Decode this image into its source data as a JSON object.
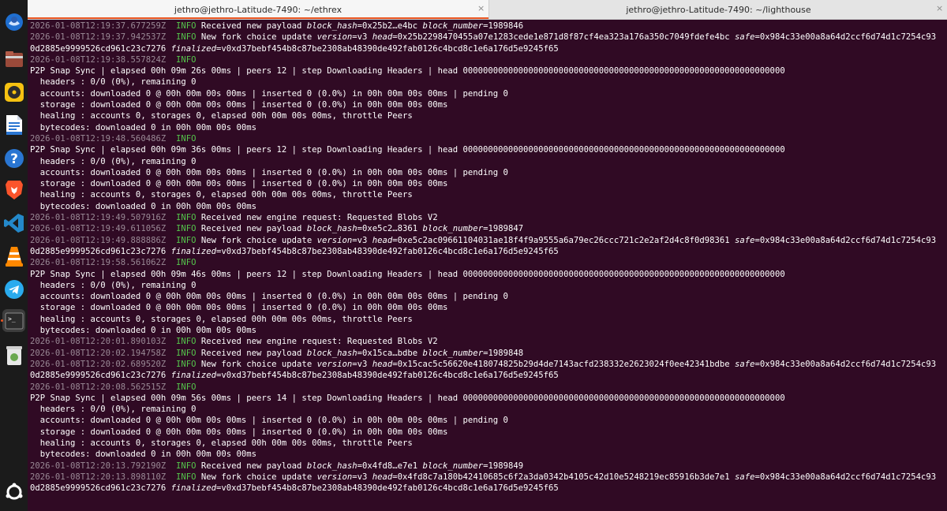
{
  "tabs": [
    {
      "title": "jethro@jethro-Latitude-7490: ~/ethrex",
      "active": true
    },
    {
      "title": "jethro@jethro-Latitude-7490: ~/lighthouse",
      "active": false
    }
  ],
  "close_glyph": "×",
  "dock": [
    {
      "name": "thunderbird-icon",
      "color": "#1f6fd1"
    },
    {
      "name": "files-icon",
      "color": "#9a4a3a"
    },
    {
      "name": "rhythmbox-icon",
      "color": "#f5c211"
    },
    {
      "name": "libreoffice-writer-icon",
      "color": "#2a76d2"
    },
    {
      "name": "help-icon",
      "color": "#2a76d2"
    },
    {
      "name": "brave-browser-icon",
      "color": "#fb542b"
    },
    {
      "name": "vscode-icon",
      "color": "#2489ca"
    },
    {
      "name": "vlc-icon",
      "color": "#ff8800"
    },
    {
      "name": "telegram-icon",
      "color": "#2aabee"
    },
    {
      "name": "terminal-icon",
      "color": "#2b2b2b"
    },
    {
      "name": "trash-icon",
      "color": "#6aa84f"
    },
    {
      "name": "show-apps-icon",
      "color": "#ffffff"
    }
  ],
  "terminal": {
    "lines": [
      [
        {
          "t": "2026-01-08T12:19:37.677259Z",
          "c": "ts"
        },
        {
          "t": "  "
        },
        {
          "t": "INFO",
          "c": "lvl"
        },
        {
          "t": " Received new payload "
        },
        {
          "t": "block_hash",
          "c": "it"
        },
        {
          "t": "=0x25b2…e4bc "
        },
        {
          "t": "block_number",
          "c": "it"
        },
        {
          "t": "=1989846"
        }
      ],
      [
        {
          "t": "2026-01-08T12:19:37.942537Z",
          "c": "ts"
        },
        {
          "t": "  "
        },
        {
          "t": "INFO",
          "c": "lvl"
        },
        {
          "t": " New fork choice update "
        },
        {
          "t": "version",
          "c": "it"
        },
        {
          "t": "=v3 "
        },
        {
          "t": "head",
          "c": "it"
        },
        {
          "t": "=0x25b2298470455a07e1283cede1e871d8f87cf4ea323a176a350c7049fdefe4bc "
        },
        {
          "t": "safe",
          "c": "it"
        },
        {
          "t": "=0x984c33e00a8a64d2ccf6d74d1c7254c93"
        }
      ],
      [
        {
          "t": "0d2885e9999526cd961c23c7276 "
        },
        {
          "t": "finalized",
          "c": "it"
        },
        {
          "t": "=v0xd37bebf454b8c87be2308ab48390de492fab0126c4bcd8c1e6a176d5e9245f65"
        }
      ],
      [
        {
          "t": "2026-01-08T12:19:38.557824Z",
          "c": "ts"
        },
        {
          "t": "  "
        },
        {
          "t": "INFO",
          "c": "lvl"
        }
      ],
      [
        {
          "t": "P2P Snap Sync | elapsed 00h 09m 26s 00ms | peers 12 | step Downloading Headers | head 0000000000000000000000000000000000000000000000000000000000000000"
        }
      ],
      [
        {
          "t": "  headers : 0/0 (0%), remaining 0"
        }
      ],
      [
        {
          "t": "  accounts: downloaded 0 @ 00h 00m 00s 00ms | inserted 0 (0.0%) in 00h 00m 00s 00ms | pending 0"
        }
      ],
      [
        {
          "t": "  storage : downloaded 0 @ 00h 00m 00s 00ms | inserted 0 (0.0%) in 00h 00m 00s 00ms"
        }
      ],
      [
        {
          "t": "  healing : accounts 0, storages 0, elapsed 00h 00m 00s 00ms, throttle Peers"
        }
      ],
      [
        {
          "t": "  bytecodes: downloaded 0 in 00h 00m 00s 00ms"
        }
      ],
      [
        {
          "t": "2026-01-08T12:19:48.560486Z",
          "c": "ts"
        },
        {
          "t": "  "
        },
        {
          "t": "INFO",
          "c": "lvl"
        }
      ],
      [
        {
          "t": "P2P Snap Sync | elapsed 00h 09m 36s 00ms | peers 12 | step Downloading Headers | head 0000000000000000000000000000000000000000000000000000000000000000"
        }
      ],
      [
        {
          "t": "  headers : 0/0 (0%), remaining 0"
        }
      ],
      [
        {
          "t": "  accounts: downloaded 0 @ 00h 00m 00s 00ms | inserted 0 (0.0%) in 00h 00m 00s 00ms | pending 0"
        }
      ],
      [
        {
          "t": "  storage : downloaded 0 @ 00h 00m 00s 00ms | inserted 0 (0.0%) in 00h 00m 00s 00ms"
        }
      ],
      [
        {
          "t": "  healing : accounts 0, storages 0, elapsed 00h 00m 00s 00ms, throttle Peers"
        }
      ],
      [
        {
          "t": "  bytecodes: downloaded 0 in 00h 00m 00s 00ms"
        }
      ],
      [
        {
          "t": "2026-01-08T12:19:49.507916Z",
          "c": "ts"
        },
        {
          "t": "  "
        },
        {
          "t": "INFO",
          "c": "lvl"
        },
        {
          "t": " Received new engine request: Requested Blobs V2"
        }
      ],
      [
        {
          "t": "2026-01-08T12:19:49.611056Z",
          "c": "ts"
        },
        {
          "t": "  "
        },
        {
          "t": "INFO",
          "c": "lvl"
        },
        {
          "t": " Received new payload "
        },
        {
          "t": "block_hash",
          "c": "it"
        },
        {
          "t": "=0xe5c2…8361 "
        },
        {
          "t": "block_number",
          "c": "it"
        },
        {
          "t": "=1989847"
        }
      ],
      [
        {
          "t": "2026-01-08T12:19:49.888886Z",
          "c": "ts"
        },
        {
          "t": "  "
        },
        {
          "t": "INFO",
          "c": "lvl"
        },
        {
          "t": " New fork choice update "
        },
        {
          "t": "version",
          "c": "it"
        },
        {
          "t": "=v3 "
        },
        {
          "t": "head",
          "c": "it"
        },
        {
          "t": "=0xe5c2ac09661104031ae18f4f9a9555a6a79ec26ccc721c2e2af2d4c8f0d98361 "
        },
        {
          "t": "safe",
          "c": "it"
        },
        {
          "t": "=0x984c33e00a8a64d2ccf6d74d1c7254c93"
        }
      ],
      [
        {
          "t": "0d2885e9999526cd961c23c7276 "
        },
        {
          "t": "finalized",
          "c": "it"
        },
        {
          "t": "=v0xd37bebf454b8c87be2308ab48390de492fab0126c4bcd8c1e6a176d5e9245f65"
        }
      ],
      [
        {
          "t": "2026-01-08T12:19:58.561062Z",
          "c": "ts"
        },
        {
          "t": "  "
        },
        {
          "t": "INFO",
          "c": "lvl"
        }
      ],
      [
        {
          "t": "P2P Snap Sync | elapsed 00h 09m 46s 00ms | peers 12 | step Downloading Headers | head 0000000000000000000000000000000000000000000000000000000000000000"
        }
      ],
      [
        {
          "t": "  headers : 0/0 (0%), remaining 0"
        }
      ],
      [
        {
          "t": "  accounts: downloaded 0 @ 00h 00m 00s 00ms | inserted 0 (0.0%) in 00h 00m 00s 00ms | pending 0"
        }
      ],
      [
        {
          "t": "  storage : downloaded 0 @ 00h 00m 00s 00ms | inserted 0 (0.0%) in 00h 00m 00s 00ms"
        }
      ],
      [
        {
          "t": "  healing : accounts 0, storages 0, elapsed 00h 00m 00s 00ms, throttle Peers"
        }
      ],
      [
        {
          "t": "  bytecodes: downloaded 0 in 00h 00m 00s 00ms"
        }
      ],
      [
        {
          "t": "2026-01-08T12:20:01.890103Z",
          "c": "ts"
        },
        {
          "t": "  "
        },
        {
          "t": "INFO",
          "c": "lvl"
        },
        {
          "t": " Received new engine request: Requested Blobs V2"
        }
      ],
      [
        {
          "t": "2026-01-08T12:20:02.194758Z",
          "c": "ts"
        },
        {
          "t": "  "
        },
        {
          "t": "INFO",
          "c": "lvl"
        },
        {
          "t": " Received new payload "
        },
        {
          "t": "block_hash",
          "c": "it"
        },
        {
          "t": "=0x15ca…bdbe "
        },
        {
          "t": "block_number",
          "c": "it"
        },
        {
          "t": "=1989848"
        }
      ],
      [
        {
          "t": "2026-01-08T12:20:02.689520Z",
          "c": "ts"
        },
        {
          "t": "  "
        },
        {
          "t": "INFO",
          "c": "lvl"
        },
        {
          "t": " New fork choice update "
        },
        {
          "t": "version",
          "c": "it"
        },
        {
          "t": "=v3 "
        },
        {
          "t": "head",
          "c": "it"
        },
        {
          "t": "=0x15cac5c56620e418074825b29d4de7143acfd238332e2623024f0ee42341bdbe "
        },
        {
          "t": "safe",
          "c": "it"
        },
        {
          "t": "=0x984c33e00a8a64d2ccf6d74d1c7254c93"
        }
      ],
      [
        {
          "t": "0d2885e9999526cd961c23c7276 "
        },
        {
          "t": "finalized",
          "c": "it"
        },
        {
          "t": "=v0xd37bebf454b8c87be2308ab48390de492fab0126c4bcd8c1e6a176d5e9245f65"
        }
      ],
      [
        {
          "t": "2026-01-08T12:20:08.562515Z",
          "c": "ts"
        },
        {
          "t": "  "
        },
        {
          "t": "INFO",
          "c": "lvl"
        }
      ],
      [
        {
          "t": "P2P Snap Sync | elapsed 00h 09m 56s 00ms | peers 14 | step Downloading Headers | head 0000000000000000000000000000000000000000000000000000000000000000"
        }
      ],
      [
        {
          "t": "  headers : 0/0 (0%), remaining 0"
        }
      ],
      [
        {
          "t": "  accounts: downloaded 0 @ 00h 00m 00s 00ms | inserted 0 (0.0%) in 00h 00m 00s 00ms | pending 0"
        }
      ],
      [
        {
          "t": "  storage : downloaded 0 @ 00h 00m 00s 00ms | inserted 0 (0.0%) in 00h 00m 00s 00ms"
        }
      ],
      [
        {
          "t": "  healing : accounts 0, storages 0, elapsed 00h 00m 00s 00ms, throttle Peers"
        }
      ],
      [
        {
          "t": "  bytecodes: downloaded 0 in 00h 00m 00s 00ms"
        }
      ],
      [
        {
          "t": "2026-01-08T12:20:13.792190Z",
          "c": "ts"
        },
        {
          "t": "  "
        },
        {
          "t": "INFO",
          "c": "lvl"
        },
        {
          "t": " Received new payload "
        },
        {
          "t": "block_hash",
          "c": "it"
        },
        {
          "t": "=0x4fd8…e7e1 "
        },
        {
          "t": "block_number",
          "c": "it"
        },
        {
          "t": "=1989849"
        }
      ],
      [
        {
          "t": "2026-01-08T12:20:13.898110Z",
          "c": "ts"
        },
        {
          "t": "  "
        },
        {
          "t": "INFO",
          "c": "lvl"
        },
        {
          "t": " New fork choice update "
        },
        {
          "t": "version",
          "c": "it"
        },
        {
          "t": "=v3 "
        },
        {
          "t": "head",
          "c": "it"
        },
        {
          "t": "=0x4fd8c7a180b42410685c6f2a3da0342b4105c42d10e5248219ec85916b3de7e1 "
        },
        {
          "t": "safe",
          "c": "it"
        },
        {
          "t": "=0x984c33e00a8a64d2ccf6d74d1c7254c93"
        }
      ],
      [
        {
          "t": "0d2885e9999526cd961c23c7276 "
        },
        {
          "t": "finalized",
          "c": "it"
        },
        {
          "t": "=v0xd37bebf454b8c87be2308ab48390de492fab0126c4bcd8c1e6a176d5e9245f65"
        }
      ]
    ]
  }
}
